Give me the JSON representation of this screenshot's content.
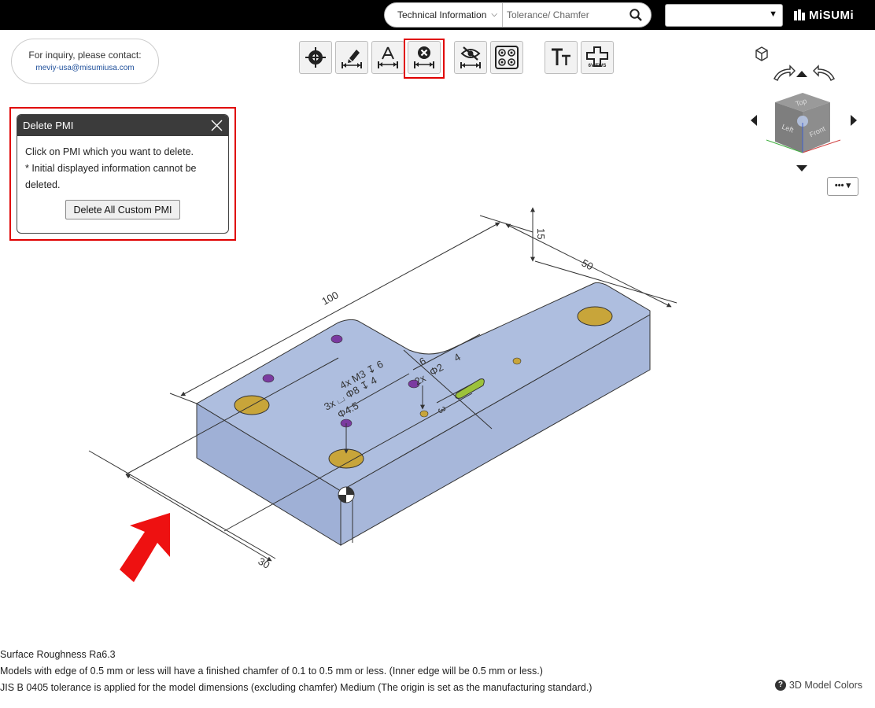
{
  "header": {
    "search_category": "Technical Information",
    "search_placeholder": "Tolerance/ Chamfer",
    "language_value": "",
    "logo_text": "MiSUMi"
  },
  "inquiry": {
    "line1": "For inquiry, please contact:",
    "email": "meviy-usa@misumiusa.com"
  },
  "toolbar": {
    "six_views_label": "6VIEWS"
  },
  "viewcube": {
    "top": "Top",
    "left": "Left",
    "front": "Front"
  },
  "panel": {
    "title": "Delete PMI",
    "line1": "Click on PMI which you want to delete.",
    "line2": "* Initial displayed information cannot be deleted.",
    "button": "Delete All Custom PMI"
  },
  "model": {
    "dim_100": "100",
    "dim_50": "50",
    "dim_15": "15",
    "dim_30": "30",
    "note_m3": "4x M3 ↧ 6",
    "note_cb": "3x ⌴ Φ8 ↧ 4",
    "note_d45": "Φ4.5",
    "dim_6": "6",
    "dim_2x": "2x",
    "dim_r2": "Φ2",
    "dim_4": "4",
    "dim_3": "3"
  },
  "notes": {
    "line1": "Surface Roughness Ra6.3",
    "line2": "Models with edge of 0.5 mm or less will have a finished chamfer of 0.1 to 0.5 mm or less. (Inner edge will be 0.5 mm or less.)",
    "line3": "JIS B 0405 tolerance is applied for the model dimensions (excluding chamfer) Medium (The origin is set as the manufacturing standard.)",
    "colors_link": "3D Model Colors"
  },
  "colors": {
    "part_face": "#a8b8dc",
    "hole_fill": "#c8a53a",
    "pmi_dot": "#7b3aa0",
    "highlight": "#e00000"
  }
}
